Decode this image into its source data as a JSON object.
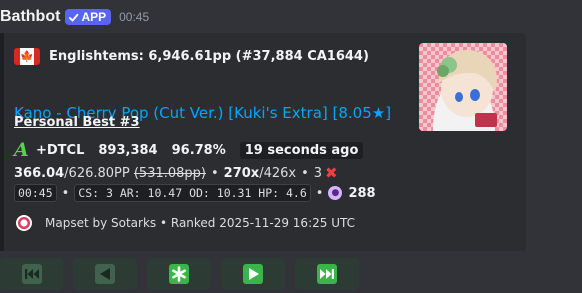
{
  "message": {
    "bot_name": "Bathbot",
    "app_badge": "APP",
    "timestamp": "00:45"
  },
  "embed": {
    "author": "Englishtems: 6,946.61pp (#37,884 CA1644)",
    "author_flag": "canada-flag",
    "title": "Kano - Cherry Pop (Cut Ver.) [Kuki's Extra] [8.05★]",
    "thumbnail": "anime-character-thumbnail",
    "personal_best": "Personal Best #3",
    "grade": "A",
    "mods": "+DTCL",
    "score": "893,384",
    "accuracy": "96.78%",
    "time_ago": "19 seconds ago",
    "pp_achieved": "366.04",
    "pp_max": "/626.80PP",
    "pp_fc": "(531.08pp)",
    "combo": "270x",
    "max_combo": "/426x",
    "misses": "3",
    "length": "00:45",
    "map_stats": "CS: 3 AR: 10.47 OD: 10.31 HP: 4.6",
    "playcount": "288",
    "footer": "Mapset by Sotarks • Ranked 2025-11-29 16:25 UTC",
    "colors": {
      "link": "#00a8fc",
      "grade": "#58d14c",
      "miss": "#f23f43"
    }
  },
  "buttons": [
    {
      "name": "first-page-button",
      "icon": "first-page-icon"
    },
    {
      "name": "previous-page-button",
      "icon": "previous-icon"
    },
    {
      "name": "jump-page-button",
      "icon": "asterisk-icon"
    },
    {
      "name": "next-page-button",
      "icon": "next-icon"
    },
    {
      "name": "last-page-button",
      "icon": "last-page-icon"
    }
  ]
}
